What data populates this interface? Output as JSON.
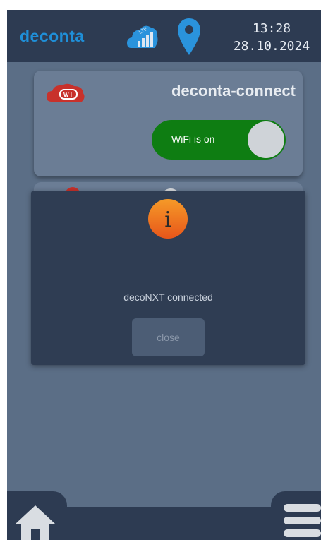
{
  "header": {
    "brand": "deconta",
    "time": "13:28",
    "date": "28.10.2024",
    "icons": [
      "lte-signal-icon",
      "location-pin-icon"
    ]
  },
  "card": {
    "title": "deconta-connect",
    "logo_text": "W I",
    "toggle_label": "WiFi is on",
    "toggle_state": "on"
  },
  "dialog": {
    "icon": "info-icon",
    "icon_glyph": "i",
    "message": "decoNXT connected",
    "close_label": "close"
  },
  "footer": {
    "icons": [
      "home-icon",
      "menu-icon"
    ]
  },
  "colors": {
    "background": "#5b6e86",
    "header": "#2d3b52",
    "brand": "#1f8fd8",
    "toggle_on": "#0e7d12",
    "dialog": "#2f3d53",
    "info_orange": "#f07a1a"
  }
}
